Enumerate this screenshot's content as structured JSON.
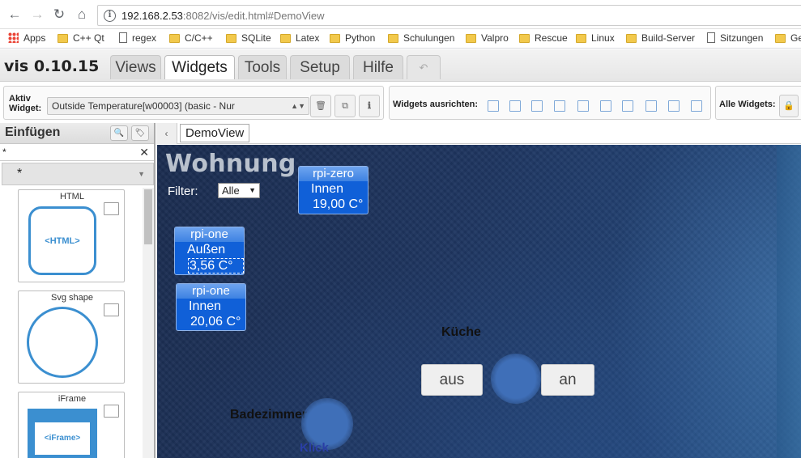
{
  "browser": {
    "url_host": "192.168.2.53",
    "url_rest": ":8082/vis/edit.html#DemoView",
    "bookmarks": [
      "Apps",
      "C++ Qt",
      "regex",
      "C/C++",
      "SQLite",
      "Latex",
      "Python",
      "Schulungen",
      "Valpro",
      "Rescue",
      "Linux",
      "Build-Server",
      "Sitzungen",
      "Ge"
    ]
  },
  "app": {
    "title": "vis 0.10.15",
    "tabs": [
      "Views",
      "Widgets",
      "Tools",
      "Setup",
      "Hilfe"
    ],
    "active_tab": "Widgets",
    "undo_icon": "undo-icon"
  },
  "toolbar": {
    "active_widget_label_1": "Aktiv",
    "active_widget_label_2": "Widget:",
    "active_widget_value": "Outside Temperature[w00003] (basic - Nur",
    "align_label": "Widgets ausrichten:",
    "all_widgets_label": "Alle Widgets:"
  },
  "left_panel": {
    "title": "Einfügen",
    "filter_value": "*",
    "set_value": "*",
    "widgets": [
      {
        "name": "HTML",
        "badge": "<HTML>"
      },
      {
        "name": "Svg shape",
        "badge": ""
      },
      {
        "name": "iFrame",
        "badge": "<iFrame>"
      }
    ]
  },
  "view_tab": "DemoView",
  "canvas": {
    "heading": "Wohnung",
    "filter_label": "Filter:",
    "filter_value": "Alle",
    "temps": [
      {
        "host": "rpi-zero",
        "location": "Innen",
        "value": "19,00 C°"
      },
      {
        "host": "rpi-one",
        "location": "Außen",
        "value": "3,56 C°"
      },
      {
        "host": "rpi-one",
        "location": "Innen",
        "value": "20,06 C°"
      }
    ],
    "room_kitchen": "Küche",
    "btn_off": "aus",
    "btn_on": "an",
    "room_bath": "Badezimmer",
    "click_label": "Klick"
  }
}
